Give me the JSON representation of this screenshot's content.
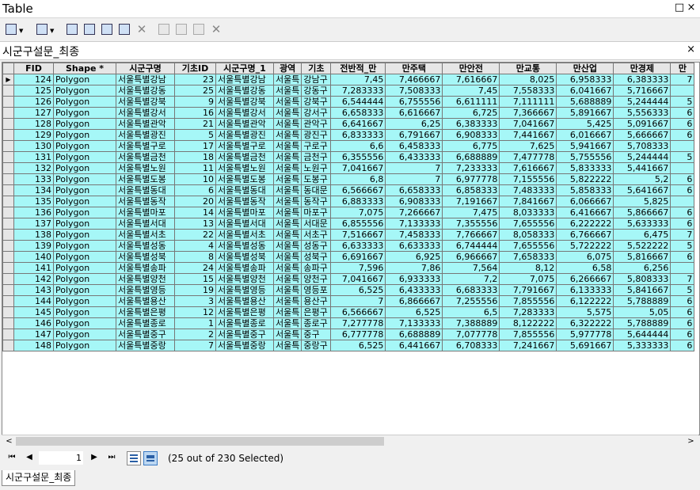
{
  "window": {
    "title": "Table",
    "pin_label": "□",
    "close_label": "×"
  },
  "table_tab": {
    "name": "시군구설문_최종",
    "close_label": "×"
  },
  "columns": [
    "FID",
    "Shape *",
    "시군구명",
    "기초ID",
    "시군구명_1",
    "광역",
    "기초",
    "전반적_만",
    "만주택",
    "만안전",
    "만교통",
    "만산업",
    "만경제",
    "만"
  ],
  "rows": [
    [
      "124",
      "Polygon",
      "서울특별강남",
      "23",
      "서울특별강남",
      "서울특",
      "강남구",
      "7,45",
      "7,466667",
      "7,616667",
      "8,025",
      "6,958333",
      "6,383333",
      "7"
    ],
    [
      "125",
      "Polygon",
      "서울특별강동",
      "25",
      "서울특별강동",
      "서울특",
      "강동구",
      "7,283333",
      "7,508333",
      "7,45",
      "7,558333",
      "6,041667",
      "5,716667",
      ""
    ],
    [
      "126",
      "Polygon",
      "서울특별강북",
      "9",
      "서울특별강북",
      "서울특",
      "강북구",
      "6,544444",
      "6,755556",
      "6,611111",
      "7,111111",
      "5,688889",
      "5,244444",
      "5"
    ],
    [
      "127",
      "Polygon",
      "서울특별강서",
      "16",
      "서울특별강서",
      "서울특",
      "강서구",
      "6,658333",
      "6,616667",
      "6,725",
      "7,366667",
      "5,891667",
      "5,556333",
      "6"
    ],
    [
      "128",
      "Polygon",
      "서울특별관악",
      "21",
      "서울특별관악",
      "서울특",
      "관악구",
      "6,641667",
      "6,25",
      "6,383333",
      "7,041667",
      "5,425",
      "5,091667",
      "6"
    ],
    [
      "129",
      "Polygon",
      "서울특별광진",
      "5",
      "서울특별광진",
      "서울특",
      "광진구",
      "6,833333",
      "6,791667",
      "6,908333",
      "7,441667",
      "6,016667",
      "5,666667",
      "6"
    ],
    [
      "130",
      "Polygon",
      "서울특별구로",
      "17",
      "서울특별구로",
      "서울특",
      "구로구",
      "6,6",
      "6,458333",
      "6,775",
      "7,625",
      "5,941667",
      "5,708333",
      ""
    ],
    [
      "131",
      "Polygon",
      "서울특별금천",
      "18",
      "서울특별금천",
      "서울특",
      "금천구",
      "6,355556",
      "6,433333",
      "6,688889",
      "7,477778",
      "5,755556",
      "5,244444",
      "5"
    ],
    [
      "132",
      "Polygon",
      "서울특별노원",
      "11",
      "서울특별노원",
      "서울특",
      "노원구",
      "7,041667",
      "7",
      "7,233333",
      "7,616667",
      "5,833333",
      "5,441667",
      ""
    ],
    [
      "133",
      "Polygon",
      "서울특별도봉",
      "10",
      "서울특별도봉",
      "서울특",
      "도봉구",
      "6,8",
      "7",
      "6,977778",
      "7,155556",
      "5,822222",
      "5,2",
      "6"
    ],
    [
      "134",
      "Polygon",
      "서울특별동대",
      "6",
      "서울특별동대",
      "서울특",
      "동대문",
      "6,566667",
      "6,658333",
      "6,858333",
      "7,483333",
      "5,858333",
      "5,641667",
      "6"
    ],
    [
      "135",
      "Polygon",
      "서울특별동작",
      "20",
      "서울특별동작",
      "서울특",
      "동작구",
      "6,883333",
      "6,908333",
      "7,191667",
      "7,841667",
      "6,066667",
      "5,825",
      ""
    ],
    [
      "136",
      "Polygon",
      "서울특별마포",
      "14",
      "서울특별마포",
      "서울특",
      "마포구",
      "7,075",
      "7,266667",
      "7,475",
      "8,033333",
      "6,416667",
      "5,866667",
      "6"
    ],
    [
      "137",
      "Polygon",
      "서울특별서대",
      "13",
      "서울특별서대",
      "서울특",
      "서대문",
      "6,855556",
      "7,133333",
      "7,355556",
      "7,655556",
      "6,222222",
      "5,633333",
      "6"
    ],
    [
      "138",
      "Polygon",
      "서울특별서초",
      "22",
      "서울특별서초",
      "서울특",
      "서초구",
      "7,516667",
      "7,458333",
      "7,766667",
      "8,058333",
      "6,766667",
      "6,475",
      "7"
    ],
    [
      "139",
      "Polygon",
      "서울특별성동",
      "4",
      "서울특별성동",
      "서울특",
      "성동구",
      "6,633333",
      "6,633333",
      "6,744444",
      "7,655556",
      "5,722222",
      "5,522222",
      "5"
    ],
    [
      "140",
      "Polygon",
      "서울특별성북",
      "8",
      "서울특별성북",
      "서울특",
      "성북구",
      "6,691667",
      "6,925",
      "6,966667",
      "7,658333",
      "6,075",
      "5,816667",
      "6"
    ],
    [
      "141",
      "Polygon",
      "서울특별송파",
      "24",
      "서울특별송파",
      "서울특",
      "송파구",
      "7,596",
      "7,86",
      "7,564",
      "8,12",
      "6,58",
      "6,256",
      ""
    ],
    [
      "142",
      "Polygon",
      "서울특별양천",
      "15",
      "서울특별양천",
      "서울특",
      "양천구",
      "7,041667",
      "6,933333",
      "7,2",
      "7,075",
      "6,266667",
      "5,808333",
      "7"
    ],
    [
      "143",
      "Polygon",
      "서울특별영등",
      "19",
      "서울특별영등",
      "서울특",
      "영등포",
      "6,525",
      "6,433333",
      "6,683333",
      "7,791667",
      "6,133333",
      "5,841667",
      "5"
    ],
    [
      "144",
      "Polygon",
      "서울특별용산",
      "3",
      "서울특별용산",
      "서울특",
      "용산구",
      "7",
      "6,866667",
      "7,255556",
      "7,855556",
      "6,122222",
      "5,788889",
      "6"
    ],
    [
      "145",
      "Polygon",
      "서울특별은평",
      "12",
      "서울특별은평",
      "서울특",
      "은평구",
      "6,566667",
      "6,525",
      "6,5",
      "7,283333",
      "5,575",
      "5,05",
      "6"
    ],
    [
      "146",
      "Polygon",
      "서울특별종로",
      "1",
      "서울특별종로",
      "서울특",
      "종로구",
      "7,277778",
      "7,133333",
      "7,388889",
      "8,122222",
      "6,322222",
      "5,788889",
      "6"
    ],
    [
      "147",
      "Polygon",
      "서울특별중구",
      "2",
      "서울특별중구",
      "서울특",
      "중구",
      "6,777778",
      "6,688889",
      "7,077778",
      "7,855556",
      "5,977778",
      "5,644444",
      "6"
    ],
    [
      "148",
      "Polygon",
      "서울특별중랑",
      "7",
      "서울특별중랑",
      "서울특",
      "중랑구",
      "6,525",
      "6,441667",
      "6,708333",
      "7,241667",
      "5,691667",
      "5,333333",
      "6"
    ]
  ],
  "current_row_marker": "▶",
  "nav": {
    "first": "⏮",
    "prev": "◀",
    "page": "1",
    "next": "▶",
    "last": "⏭"
  },
  "selection_status": "(25 out of 230 Selected)",
  "bottom_tab": "시군구설문_최종",
  "scroll": {
    "left_arrow": "<",
    "right_arrow": ">"
  }
}
